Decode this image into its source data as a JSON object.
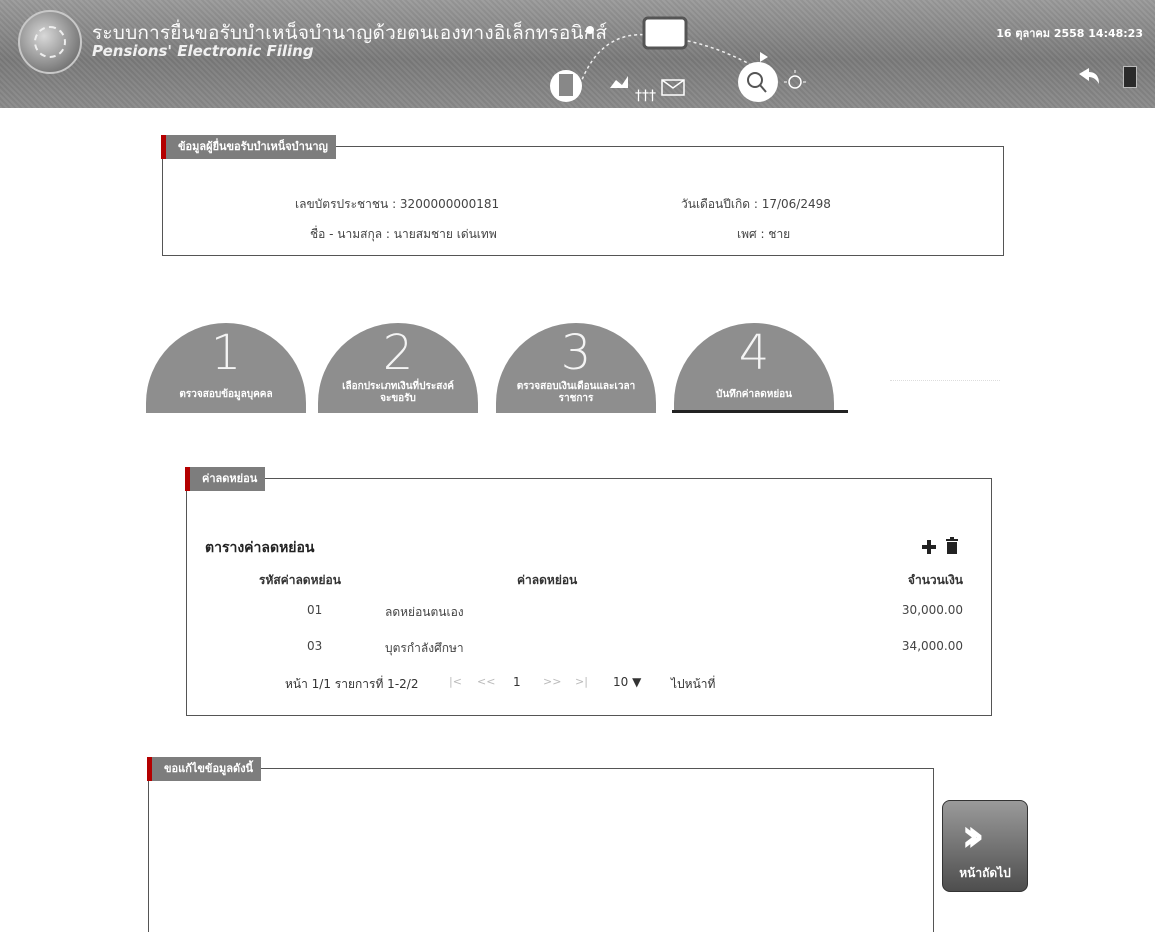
{
  "header": {
    "title_th": "ระบบการยื่นขอรับบำเหน็จบำนาญด้วยตนเองทางอิเล็กทรอนิกส์",
    "title_en": "Pensions' Electronic Filing",
    "datetime": "16 ตุลาคม 2558 14:48:23"
  },
  "person": {
    "legend": "ข้อมูลผู้ยื่นขอรับบำเหน็จบำนาญ",
    "id_label": "เลขบัตรประชาชน : 3200000000181",
    "birth_label": "วันเดือนปีเกิด : 17/06/2498",
    "name_label": "ชื่อ - นามสกุล : นายสมชาย เด่นเทพ",
    "gender_label": "เพศ : ชาย"
  },
  "steps": [
    {
      "number": "1",
      "label": "ตรวจสอบข้อมูลบุคคล"
    },
    {
      "number": "2",
      "label": "เลือกประเภทเงินที่ประสงค์จะขอรับ"
    },
    {
      "number": "3",
      "label": "ตรวจสอบเงินเดือนและเวลาราชการ"
    },
    {
      "number": "4",
      "label": "บันทึกค่าลดหย่อน"
    }
  ],
  "deduction": {
    "legend": "ค่าลดหย่อน",
    "table_title": "ตารางค่าลดหย่อน",
    "headers": [
      "รหัสค่าลดหย่อน",
      "ค่าลดหย่อน",
      "จำนวนเงิน"
    ],
    "rows": [
      {
        "code": "01",
        "name": "ลดหย่อนตนเอง",
        "amount": "30,000.00"
      },
      {
        "code": "03",
        "name": "บุตรกำลังศึกษา",
        "amount": "34,000.00"
      }
    ],
    "pager": {
      "info": "หน้า 1/1 รายการที่ 1-2/2",
      "first": "|<",
      "prev": "<<",
      "page": "1",
      "next": ">>",
      "last": ">|",
      "page_size": "10 ▼",
      "goto": "ไปหน้าที่"
    }
  },
  "remark": {
    "legend": "ขอแก้ไขข้อมูลดังนี้"
  },
  "next_button": {
    "label": "หน้าถัดไป"
  }
}
